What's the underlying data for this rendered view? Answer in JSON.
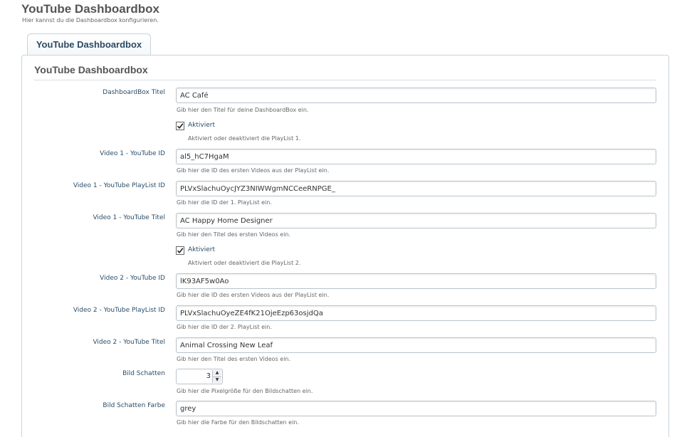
{
  "header": {
    "title": "YouTube Dashboardbox",
    "subtitle": "Hier kannst du die Dashboardbox konfigurieren."
  },
  "tab": {
    "label": "YouTube Dashboardbox"
  },
  "section": {
    "title": "YouTube Dashboardbox"
  },
  "fields": {
    "box_title": {
      "label": "DashboardBox Titel",
      "value": "AC Café",
      "hint": "Gib hier den Titel für deine DashboardBox ein."
    },
    "active1": {
      "label": "Aktiviert",
      "hint": "Aktiviert oder deaktiviert die PlayList 1.",
      "checked": true
    },
    "v1_id": {
      "label": "Video 1 - YouTube ID",
      "value": "al5_hC7HgaM",
      "hint": "Gib hier die ID des ersten Videos aus der PlayList ein."
    },
    "v1_playlist": {
      "label": "Video 1 - YouTube PlayList ID",
      "value": "PLVxSlachuOycJYZ3NIWWgmNCCeeRNPGE_",
      "hint": "Gib hier die ID der 1. PlayList ein."
    },
    "v1_title": {
      "label": "Video 1 - YouTube Titel",
      "value": "AC Happy Home Designer",
      "hint": "Gib hier den Titel des ersten Videos ein."
    },
    "active2": {
      "label": "Aktiviert",
      "hint": "Aktiviert oder deaktiviert die PlayList 2.",
      "checked": true
    },
    "v2_id": {
      "label": "Video 2 - YouTube ID",
      "value": "lK93AF5w0Ao",
      "hint": "Gib hier die ID des ersten Videos aus der PlayList ein."
    },
    "v2_playlist": {
      "label": "Video 2 - YouTube PlayList ID",
      "value": "PLVxSlachuOyeZE4fK21OjeEzp63osjdQa",
      "hint": "Gib hier die ID der 2. PlayList ein."
    },
    "v2_title": {
      "label": "Video 2 - YouTube Titel",
      "value": "Animal Crossing New Leaf",
      "hint": "Gib hier den Titel des ersten Videos ein."
    },
    "shadow": {
      "label": "Bild Schatten",
      "value": "3",
      "hint": "Gib hier die Pixelgröße für den Bildschatten ein."
    },
    "shadow_color": {
      "label": "Bild Schatten Farbe",
      "value": "grey",
      "hint": "Gib hier die Farbe für den Bildschatten ein."
    }
  },
  "colors": {
    "label": "#2b4c69",
    "tab_text": "#2c4a63",
    "border": "#c8d3dc"
  },
  "icons": {
    "check": "checkmark-icon",
    "spin_up": "spin-up-icon",
    "spin_down": "spin-down-icon"
  }
}
